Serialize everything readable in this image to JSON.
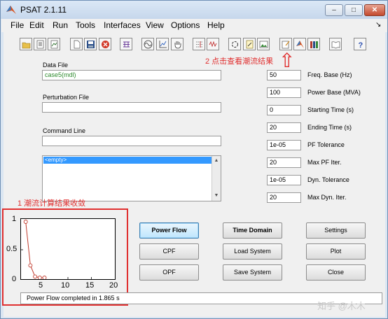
{
  "window": {
    "title": "PSAT 2.1.11",
    "minimize_glyph": "–",
    "maximize_glyph": "□",
    "close_glyph": "✕"
  },
  "menu": [
    "File",
    "Edit",
    "Run",
    "Tools",
    "Interfaces",
    "View",
    "Options",
    "Help"
  ],
  "menu_arrow": "↘",
  "toolbar_icons": [
    "open-folder-icon",
    "open-data-icon",
    "open-perturbation-icon",
    "new-file-icon",
    "save-icon",
    "stop-icon",
    "network-icon",
    "sine-wave-icon",
    "chart-icon",
    "hand-icon",
    "settings-grid-icon",
    "wave-plot-icon",
    "refresh-icon",
    "edit-icon",
    "image-icon",
    "report-icon",
    "matlab-icon",
    "library-icon",
    "book-icon",
    "help-icon"
  ],
  "annotations": {
    "view_results": "2 点击查看潮流结果",
    "convergence": "1 潮流计算结果收敛",
    "arrow_glyph": "⇧"
  },
  "fields": {
    "data_file_label": "Data File",
    "data_file_value": "case5(mdl)",
    "perturbation_file_label": "Perturbation File",
    "perturbation_file_value": "",
    "command_line_label": "Command Line",
    "command_line_value": "",
    "command_list_selected": "<empty>",
    "scroll_up_glyph": "▲",
    "scroll_down_glyph": "▼"
  },
  "parameters": [
    {
      "value": "50",
      "label": "Freq. Base (Hz)"
    },
    {
      "value": "100",
      "label": "Power Base (MVA)"
    },
    {
      "value": "0",
      "label": "Starting Time (s)"
    },
    {
      "value": "20",
      "label": "Ending Time (s)"
    },
    {
      "value": "1e-05",
      "label": "PF Tolerance"
    },
    {
      "value": "20",
      "label": "Max PF Iter."
    },
    {
      "value": "1e-05",
      "label": "Dyn. Tolerance"
    },
    {
      "value": "20",
      "label": "Max Dyn. Iter."
    }
  ],
  "buttons": {
    "power_flow": "Power Flow",
    "time_domain": "Time Domain",
    "settings": "Settings",
    "cpf": "CPF",
    "load_system": "Load System",
    "plot": "Plot",
    "opf": "OPF",
    "save_system": "Save System",
    "close": "Close"
  },
  "status": "Power Flow completed in 1.865 s",
  "watermark": "知乎 @木木",
  "colors": {
    "annotation_red": "#e03030",
    "series_red": "#c0392b",
    "data_file_green": "#2e8b2e",
    "selection_blue": "#3399ff"
  },
  "chart_data": {
    "type": "line",
    "x": [
      1,
      2,
      3,
      4,
      5
    ],
    "y": [
      1.0,
      0.22,
      0.02,
      0.0,
      0.0
    ],
    "xlim": [
      0,
      20
    ],
    "ylim": [
      0,
      1
    ],
    "x_ticks": [
      "5",
      "10",
      "15",
      "20"
    ],
    "y_ticks": [
      "1",
      "0.5",
      "0"
    ],
    "markers": "circle",
    "grid": false
  }
}
